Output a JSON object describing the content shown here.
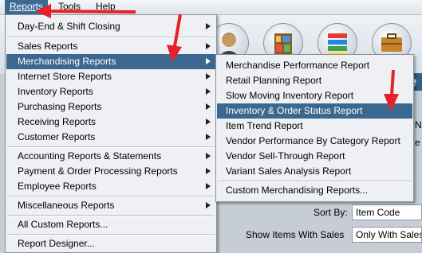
{
  "menubar": {
    "items": [
      {
        "label": "Reports"
      },
      {
        "label": "Tools"
      },
      {
        "label": "Help"
      }
    ]
  },
  "background": {
    "banner_letter": "e",
    "sort_by_label": "Sort By:",
    "sort_by_value": "Item Code",
    "show_items_label": "Show Items With Sales",
    "show_items_value": "Only With Sales",
    "fragment_n": "N",
    "fragment_e": "e"
  },
  "reports_menu": {
    "items": [
      {
        "label": "Day-End & Shift Closing",
        "submenu": true
      },
      {
        "label": "Sales Reports",
        "submenu": true
      },
      {
        "label": "Merchandising Reports",
        "submenu": true,
        "highlighted": true
      },
      {
        "label": "Internet Store Reports",
        "submenu": true
      },
      {
        "label": "Inventory Reports",
        "submenu": true
      },
      {
        "label": "Purchasing Reports",
        "submenu": true
      },
      {
        "label": "Receiving Reports",
        "submenu": true
      },
      {
        "label": "Customer Reports",
        "submenu": true
      },
      {
        "label": "Accounting Reports & Statements",
        "submenu": true
      },
      {
        "label": "Payment & Order Processing Reports",
        "submenu": true
      },
      {
        "label": "Employee Reports",
        "submenu": true
      },
      {
        "label": "Miscellaneous Reports",
        "submenu": true
      },
      {
        "label": "All Custom Reports...",
        "submenu": false
      },
      {
        "label": "Report Designer...",
        "submenu": false
      }
    ]
  },
  "merchandising_submenu": {
    "items": [
      {
        "label": "Merchandise Performance Report"
      },
      {
        "label": "Retail Planning Report"
      },
      {
        "label": "Slow Moving Inventory Report"
      },
      {
        "label": "Inventory & Order Status Report",
        "highlighted": true
      },
      {
        "label": "Item Trend Report"
      },
      {
        "label": "Vendor Performance By Category Report"
      },
      {
        "label": "Vendor Sell-Through Report"
      },
      {
        "label": "Variant Sales Analysis Report"
      },
      {
        "label": "Custom Merchandising Reports..."
      }
    ]
  },
  "colors": {
    "highlight": "#3a6890",
    "annotation_arrow": "#e8202a"
  }
}
